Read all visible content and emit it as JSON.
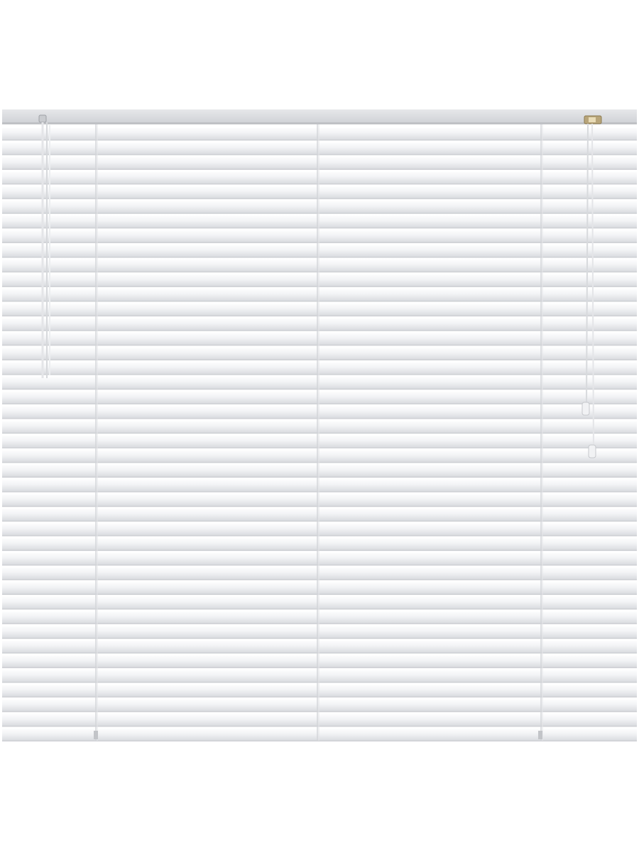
{
  "photo": {
    "subject": "",
    "colors": {
      "background": "#ffffff",
      "headrail": "#dcdde0",
      "headrail_edge": "#c3c5c9",
      "slat_light": "#f4f5f7",
      "slat_mid": "#e6e7ea",
      "slat_shadow": "#cfd1d5",
      "ladder": "#d2d4d8",
      "cord": "#e8e9ec",
      "tilt_mechanism": "#b8a57a"
    },
    "slat_count": 42
  }
}
